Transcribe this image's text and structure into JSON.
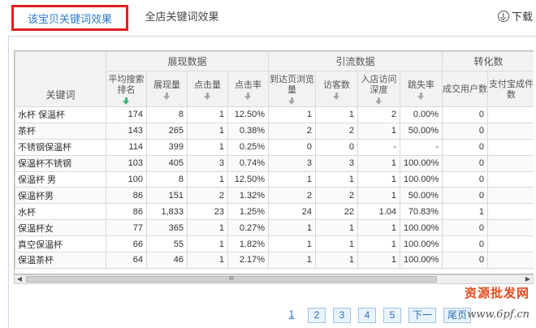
{
  "tabs": {
    "active": "该宝贝关键词效果",
    "inactive": "全店关键词效果"
  },
  "download": {
    "label": "下载"
  },
  "table": {
    "keyword_header": "关键词",
    "groups": [
      "展现数据",
      "引流数据",
      "转化数"
    ],
    "columns": [
      "平均搜索排名",
      "展现量",
      "点击量",
      "点击率",
      "到达页浏览量",
      "访客数",
      "入店访问深度",
      "跳失率",
      "成交用户数",
      "支付宝成件数"
    ],
    "rows": [
      [
        "水杯 保温杯",
        "174",
        "8",
        "1",
        "12.50%",
        "1",
        "1",
        "2",
        "0.00%",
        "0",
        ""
      ],
      [
        "茶杯",
        "143",
        "265",
        "1",
        "0.38%",
        "2",
        "2",
        "1",
        "50.00%",
        "0",
        ""
      ],
      [
        "不锈钢保温杯",
        "114",
        "399",
        "1",
        "0.25%",
        "0",
        "0",
        "-",
        "-",
        "0",
        ""
      ],
      [
        "保温杯不锈钢",
        "103",
        "405",
        "3",
        "0.74%",
        "3",
        "3",
        "1",
        "100.00%",
        "0",
        ""
      ],
      [
        "保温杯 男",
        "100",
        "8",
        "1",
        "12.50%",
        "1",
        "1",
        "1",
        "100.00%",
        "0",
        ""
      ],
      [
        "保温杯男",
        "86",
        "151",
        "2",
        "1.32%",
        "2",
        "2",
        "1",
        "50.00%",
        "0",
        ""
      ],
      [
        "水杯",
        "86",
        "1,833",
        "23",
        "1.25%",
        "24",
        "22",
        "1.04",
        "70.83%",
        "1",
        ""
      ],
      [
        "保温杯女",
        "77",
        "365",
        "1",
        "0.27%",
        "1",
        "1",
        "1",
        "100.00%",
        "0",
        ""
      ],
      [
        "真空保温杯",
        "66",
        "55",
        "1",
        "1.82%",
        "1",
        "1",
        "1",
        "100.00%",
        "0",
        ""
      ],
      [
        "保温茶杯",
        "64",
        "46",
        "1",
        "2.17%",
        "1",
        "1",
        "1",
        "100.00%",
        "0",
        ""
      ]
    ]
  },
  "scrollbar": {
    "grip": "III"
  },
  "pagination": [
    "1",
    "2",
    "3",
    "4",
    "5",
    "下一",
    "尾页"
  ],
  "watermark": {
    "text": "资源批发网",
    "url": "www.6pf.cn"
  },
  "colors": {
    "accent": "#2a7ac8",
    "highlight_border": "#e02020",
    "sort_active": "#3cb371"
  }
}
